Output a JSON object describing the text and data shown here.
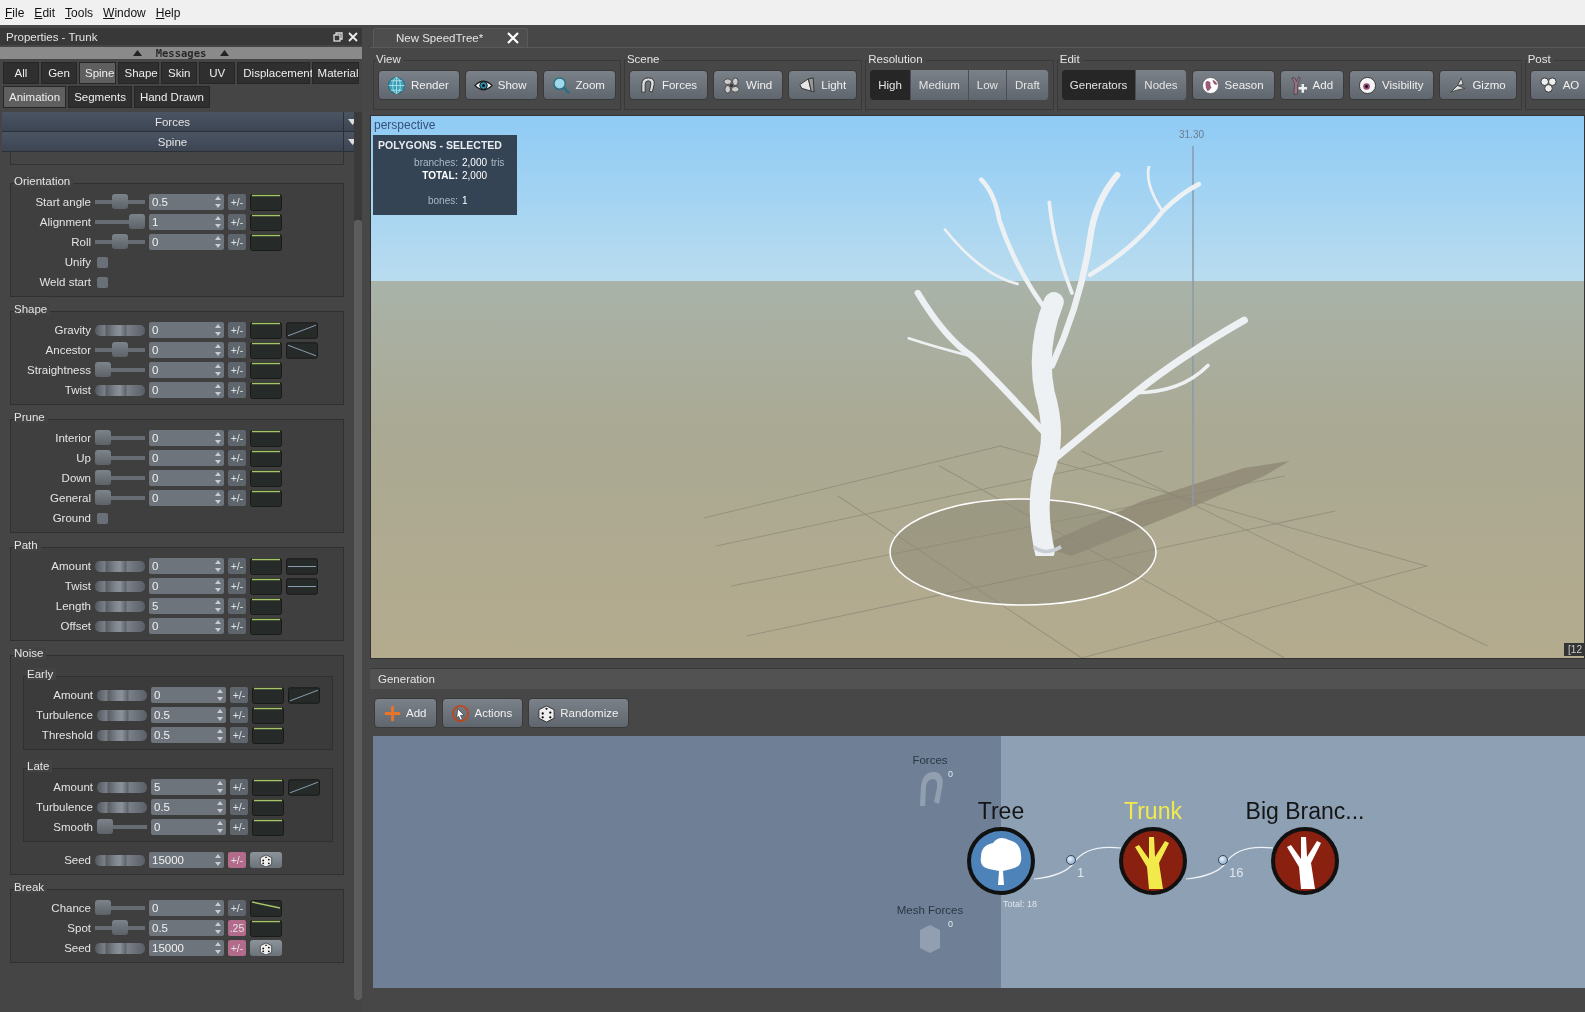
{
  "menu": [
    "File",
    "Edit",
    "Tools",
    "Window",
    "Help"
  ],
  "properties": {
    "title": "Properties - Trunk",
    "messages_bar": "Messages",
    "tabs": [
      {
        "label": "All",
        "selected": false
      },
      {
        "label": "Gen",
        "selected": false
      },
      {
        "label": "Spine",
        "selected": true
      },
      {
        "label": "Shape",
        "selected": false
      },
      {
        "label": "Skin",
        "selected": false
      },
      {
        "label": "UV",
        "selected": false
      },
      {
        "label": "Displacement",
        "selected": false
      },
      {
        "label": "Material",
        "selected": false
      },
      {
        "label": "Animation",
        "selected": true
      },
      {
        "label": "Segments",
        "selected": false
      },
      {
        "label": "Hand Drawn",
        "selected": false
      }
    ],
    "sections": [
      "Forces",
      "Spine"
    ],
    "groups": [
      {
        "title": "Orientation",
        "rows": [
          {
            "label": "Start angle",
            "kind": "thumb",
            "level": 0.5,
            "value": "0.5",
            "variance": "+/-",
            "variance_set": false,
            "curve": {
              "kind": "flat"
            }
          },
          {
            "label": "Alignment",
            "kind": "thumb",
            "level": 1,
            "value": "1",
            "variance": "+/-",
            "variance_set": false,
            "curve": {
              "kind": "flat"
            }
          },
          {
            "label": "Roll",
            "kind": "thumb",
            "level": 0.5,
            "value": "0",
            "variance": "+/-",
            "variance_set": false,
            "curve": {
              "kind": "flat"
            }
          },
          {
            "label": "Unify",
            "kind": "checkbox",
            "checked": false
          },
          {
            "label": "Weld start",
            "kind": "checkbox",
            "checked": false
          }
        ]
      },
      {
        "title": "Shape",
        "rows": [
          {
            "label": "Gravity",
            "kind": "dial",
            "value": "0",
            "variance": "+/-",
            "variance_set": false,
            "curve": {
              "kind": "flat"
            },
            "profile": {
              "kind": "rising"
            }
          },
          {
            "label": "Ancestor",
            "kind": "thumb",
            "level": 0.5,
            "value": "0",
            "variance": "+/-",
            "variance_set": false,
            "curve": {
              "kind": "flat"
            },
            "profile": {
              "kind": "falling"
            }
          },
          {
            "label": "Straightness",
            "kind": "thumb",
            "level": 0,
            "value": "0",
            "variance": "+/-",
            "variance_set": false,
            "curve": {
              "kind": "flat"
            }
          },
          {
            "label": "Twist",
            "kind": "dial",
            "value": "0",
            "variance": "+/-",
            "variance_set": false,
            "curve": {
              "kind": "flat"
            }
          }
        ]
      },
      {
        "title": "Prune",
        "rows": [
          {
            "label": "Interior",
            "kind": "thumb",
            "level": 0,
            "value": "0",
            "variance": "+/-",
            "variance_set": false,
            "curve": {
              "kind": "flat"
            }
          },
          {
            "label": "Up",
            "kind": "thumb",
            "level": 0,
            "value": "0",
            "variance": "+/-",
            "variance_set": false,
            "curve": {
              "kind": "flat"
            }
          },
          {
            "label": "Down",
            "kind": "thumb",
            "level": 0,
            "value": "0",
            "variance": "+/-",
            "variance_set": false,
            "curve": {
              "kind": "flat"
            }
          },
          {
            "label": "General",
            "kind": "thumb",
            "level": 0,
            "value": "0",
            "variance": "+/-",
            "variance_set": false,
            "curve": {
              "kind": "flat"
            }
          },
          {
            "label": "Ground",
            "kind": "checkbox",
            "checked": false
          }
        ]
      },
      {
        "title": "Path",
        "rows": [
          {
            "label": "Amount",
            "kind": "dial",
            "value": "0",
            "variance": "+/-",
            "variance_set": false,
            "curve": {
              "kind": "flat"
            },
            "profile": {
              "kind": "flat"
            }
          },
          {
            "label": "Twist",
            "kind": "dial",
            "value": "0",
            "variance": "+/-",
            "variance_set": false,
            "curve": {
              "kind": "flat"
            },
            "profile": {
              "kind": "flat"
            }
          },
          {
            "label": "Length",
            "kind": "dial",
            "value": "5",
            "variance": "+/-",
            "variance_set": false,
            "curve": {
              "kind": "flat"
            }
          },
          {
            "label": "Offset",
            "kind": "dial",
            "value": "0",
            "variance": "+/-",
            "variance_set": false,
            "curve": {
              "kind": "flat"
            }
          }
        ]
      },
      {
        "title": "Noise",
        "subgroups": [
          {
            "title": "Early",
            "rows": [
              {
                "label": "Amount",
                "kind": "dial",
                "value": "0",
                "variance": "+/-",
                "variance_set": false,
                "curve": {
                  "kind": "flat"
                },
                "profile": {
                  "kind": "rising"
                }
              },
              {
                "label": "Turbulence",
                "kind": "dial",
                "value": "0.5",
                "variance": "+/-",
                "variance_set": false,
                "curve": {
                  "kind": "flat"
                }
              },
              {
                "label": "Threshold",
                "kind": "dial",
                "value": "0.5",
                "variance": "+/-",
                "variance_set": false,
                "curve": {
                  "kind": "flat"
                }
              }
            ]
          },
          {
            "title": "Late",
            "rows": [
              {
                "label": "Amount",
                "kind": "dial",
                "value": "5",
                "variance": "+/-",
                "variance_set": false,
                "curve": {
                  "kind": "flat"
                },
                "profile": {
                  "kind": "rising"
                }
              },
              {
                "label": "Turbulence",
                "kind": "dial",
                "value": "0.5",
                "variance": "+/-",
                "variance_set": false,
                "curve": {
                  "kind": "flat"
                }
              },
              {
                "label": "Smooth",
                "kind": "thumb",
                "level": 0,
                "value": "0",
                "variance": "+/-",
                "variance_set": false,
                "curve": {
                  "kind": "flat"
                }
              }
            ]
          }
        ],
        "rows": [
          {
            "label": "Seed",
            "kind": "dial",
            "value": "15000",
            "variance": "+/-",
            "variance_set": true,
            "dice": true
          }
        ]
      },
      {
        "title": "Break",
        "rows": [
          {
            "label": "Chance",
            "kind": "thumb",
            "level": 0,
            "value": "0",
            "variance": "+/-",
            "variance_set": false,
            "curve": {
              "kind": "falling"
            }
          },
          {
            "label": "Spot",
            "kind": "thumb",
            "level": 0.5,
            "value": "0.5",
            "variance": ".25",
            "variance_set": true,
            "curve": {
              "kind": "flat"
            }
          },
          {
            "label": "Seed",
            "kind": "dial",
            "value": "15000",
            "variance": "+/-",
            "variance_set": true,
            "dice": true
          }
        ]
      }
    ]
  },
  "document_tab": {
    "title": "New SpeedTree*"
  },
  "toolbar": [
    {
      "title": "View",
      "buttons": [
        "Render",
        "Show",
        "Zoom"
      ]
    },
    {
      "title": "Scene",
      "buttons": [
        "Forces",
        "Wind",
        "Light"
      ]
    },
    {
      "title": "Resolution",
      "segments": [
        {
          "label": "High",
          "selected": true
        },
        {
          "label": "Medium",
          "selected": false
        },
        {
          "label": "Low",
          "selected": false
        },
        {
          "label": "Draft",
          "selected": false
        }
      ]
    },
    {
      "title": "Edit",
      "segments": [
        {
          "label": "Generators",
          "selected": true
        },
        {
          "label": "Nodes",
          "selected": false
        }
      ],
      "buttons": [
        "Season",
        "Add",
        "Visibility",
        "Gizmo"
      ]
    },
    {
      "title": "Post",
      "buttons": [
        "AO"
      ]
    }
  ],
  "viewport": {
    "label": "perspective",
    "stats_title": "POLYGONS - SELECTED",
    "stats": [
      {
        "key": "branches:",
        "value": "2,000",
        "unit": "tris"
      },
      {
        "key": "TOTAL:",
        "value": "2,000"
      },
      {
        "key": "bones:",
        "value": "1"
      }
    ],
    "height_marker": "31.30",
    "corner_text": "[12"
  },
  "generation": {
    "title": "Generation",
    "buttons": [
      "Add",
      "Actions",
      "Randomize"
    ],
    "aux_nodes": [
      {
        "label": "Forces",
        "count": "0"
      },
      {
        "label": "Mesh Forces",
        "count": "0"
      }
    ],
    "nodes": [
      {
        "label": "Tree",
        "kind": "root",
        "selected": false
      },
      {
        "label": "Trunk",
        "kind": "branch",
        "selected": true
      },
      {
        "label": "Big Branc...",
        "kind": "branch",
        "selected": false
      }
    ],
    "links": [
      "1",
      "16"
    ],
    "total": "Total: 18"
  }
}
